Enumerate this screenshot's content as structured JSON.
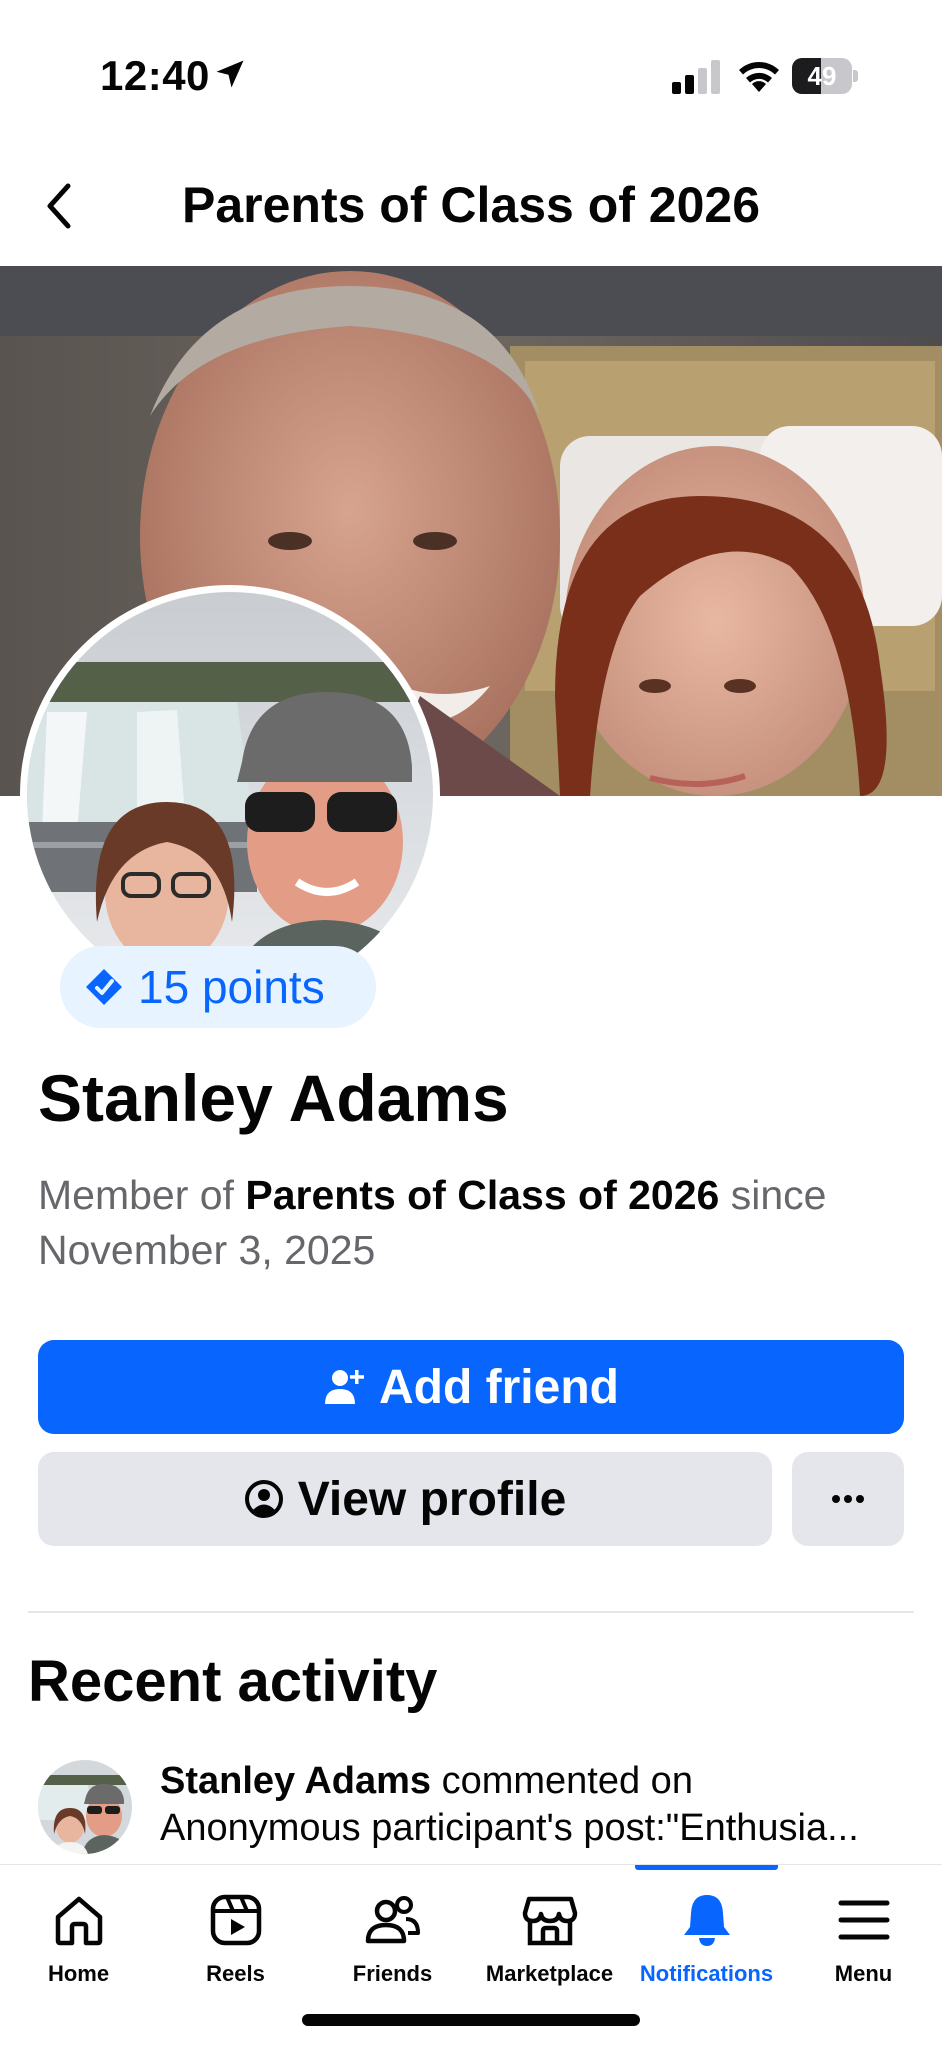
{
  "status_bar": {
    "time": "12:40",
    "battery": "49",
    "battery_level": 0.49
  },
  "header": {
    "title": "Parents of Class of 2026"
  },
  "profile": {
    "points": "15 points",
    "name": "Stanley Adams",
    "member_prefix": "Member of ",
    "group_name": "Parents of Class of 2026",
    "since_word": " since",
    "join_date": "November 3, 2025"
  },
  "actions": {
    "add_friend": "Add friend",
    "view_profile": "View profile",
    "more": "···"
  },
  "recent_activity": {
    "title": "Recent activity",
    "items": [
      {
        "actor": "Stanley Adams",
        "action": " commented on",
        "detail": "Anonymous participant's post:\"Enthusia..."
      }
    ]
  },
  "bottom_nav": {
    "items": [
      {
        "label": "Home",
        "icon": "home-icon"
      },
      {
        "label": "Reels",
        "icon": "reels-icon"
      },
      {
        "label": "Friends",
        "icon": "friends-icon"
      },
      {
        "label": "Marketplace",
        "icon": "marketplace-icon"
      },
      {
        "label": "Notifications",
        "icon": "bell-icon",
        "active": true
      },
      {
        "label": "Menu",
        "icon": "menu-icon"
      }
    ]
  },
  "colors": {
    "accent": "#0866ff",
    "secondary_button": "#e4e6eb",
    "muted_text": "#65676b",
    "points_bg": "#e7f3ff"
  }
}
